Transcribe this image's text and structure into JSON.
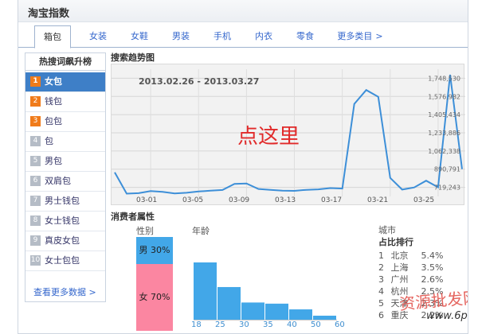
{
  "header": {
    "title": "淘宝指数"
  },
  "tabs": [
    {
      "label": "箱包",
      "active": true
    },
    {
      "label": "女装"
    },
    {
      "label": "女鞋"
    },
    {
      "label": "男装"
    },
    {
      "label": "手机"
    },
    {
      "label": "内衣"
    },
    {
      "label": "零食"
    },
    {
      "label": "更多类目",
      "arrow": ">"
    }
  ],
  "sidebar": {
    "title": "热搜词飙升榜",
    "items": [
      {
        "rank": "1",
        "label": "女包"
      },
      {
        "rank": "2",
        "label": "钱包"
      },
      {
        "rank": "3",
        "label": "包包"
      },
      {
        "rank": "4",
        "label": "包"
      },
      {
        "rank": "5",
        "label": "男包"
      },
      {
        "rank": "6",
        "label": "双肩包"
      },
      {
        "rank": "7",
        "label": "男士钱包"
      },
      {
        "rank": "8",
        "label": "女士钱包"
      },
      {
        "rank": "9",
        "label": "真皮女包"
      },
      {
        "rank": "10",
        "label": "女士包包"
      }
    ],
    "more": "查看更多数据 >"
  },
  "trend": {
    "title": "搜索趋势图",
    "date_range": "2013.02.26 - 2013.03.27",
    "overlay_text": "点这里"
  },
  "consumer": {
    "title": "消费者属性",
    "gender_label": "性别",
    "age_label": "年龄",
    "city_label": "城市",
    "city_rank_title": "占比排行",
    "gender": {
      "male": "男 30%",
      "female": "女 70%",
      "male_share": 30,
      "female_share": 70
    },
    "cities": [
      {
        "rank": "1",
        "name": "北京",
        "pct": "5.4%"
      },
      {
        "rank": "2",
        "name": "上海",
        "pct": "3.5%"
      },
      {
        "rank": "3",
        "name": "广州",
        "pct": "2.6%"
      },
      {
        "rank": "4",
        "name": "杭州",
        "pct": "2.5%"
      },
      {
        "rank": "5",
        "name": "天津",
        "pct": "2.3%"
      },
      {
        "rank": "6",
        "name": "重庆",
        "pct": "2.2%"
      }
    ]
  },
  "watermark": {
    "line1": "资源批发网",
    "line2": "www.6pf.cn"
  },
  "chart_data": [
    {
      "type": "line",
      "title": "搜索趋势图",
      "subtitle": "2013.02.26 - 2013.03.27",
      "x_ticks": [
        "03-01",
        "03-05",
        "03-09",
        "03-13",
        "03-17",
        "03-21",
        "03-25"
      ],
      "y_ticks": [
        "719,243",
        "890,791",
        "1,062,338",
        "1,233,886",
        "1,405,434",
        "1,576,982",
        "1,748,530"
      ],
      "ylim": [
        633469,
        1834304
      ],
      "x": [
        "02-26",
        "02-27",
        "02-28",
        "03-01",
        "03-02",
        "03-03",
        "03-04",
        "03-05",
        "03-06",
        "03-07",
        "03-08",
        "03-09",
        "03-10",
        "03-11",
        "03-12",
        "03-13",
        "03-14",
        "03-15",
        "03-16",
        "03-17",
        "03-18",
        "03-19",
        "03-20",
        "03-21",
        "03-22",
        "03-23",
        "03-24",
        "03-25",
        "03-26",
        "03-27"
      ],
      "values": [
        860000,
        660000,
        664000,
        684000,
        676000,
        662000,
        668000,
        680000,
        688000,
        694000,
        752000,
        756000,
        704000,
        696000,
        688000,
        686000,
        696000,
        700000,
        712000,
        708000,
        1506000,
        1638000,
        1574000,
        808000,
        698000,
        718000,
        782000,
        720000,
        1782000,
        892000
      ],
      "grid": true,
      "line_color": "#3d8fd8"
    },
    {
      "type": "bar",
      "title": "年龄",
      "categories": [
        "18",
        "25",
        "30",
        "35",
        "40",
        "50",
        "60"
      ],
      "values": [
        1.0,
        0.57,
        0.3,
        0.28,
        0.18,
        0.07
      ],
      "bar_color": "#42a7e8"
    }
  ]
}
